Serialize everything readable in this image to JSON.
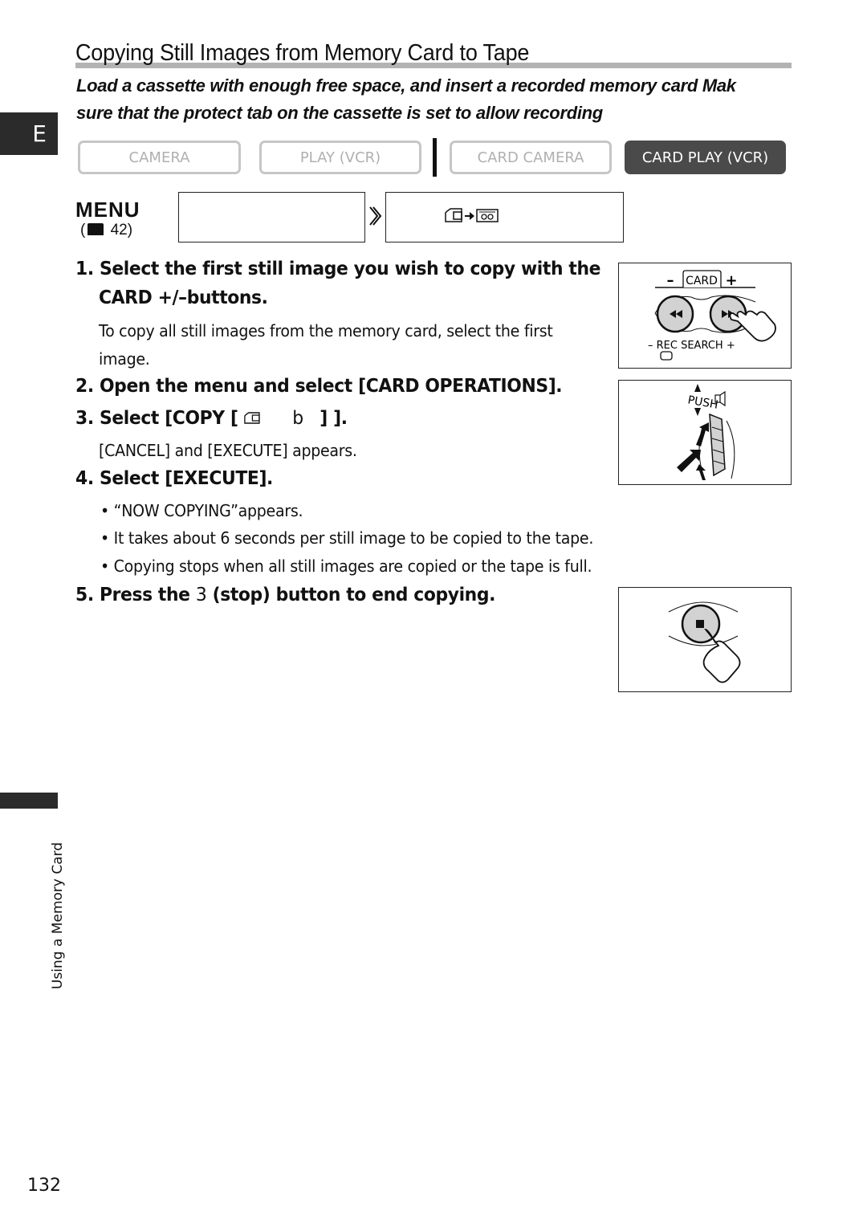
{
  "header": {
    "title": "Copying Still Images from Memory Card to Tape",
    "intro_line1": "Load a cassette with enough free space, and insert a recorded memory card  Mak",
    "intro_line2": "sure that the protect tab on the cassette is set to allow recording"
  },
  "language_tab": "E",
  "modes": [
    {
      "label": "CAMERA",
      "active": false
    },
    {
      "label": "PLAY (VCR)",
      "active": false
    },
    {
      "label": "CARD CAMERA",
      "active": false
    },
    {
      "label": "CARD PLAY (VCR)",
      "active": true
    }
  ],
  "menu": {
    "label": "MENU",
    "page_ref": "42",
    "box1_text": "",
    "box2_icon": "card-to-tape-icon"
  },
  "steps": [
    {
      "number": "1.",
      "line1": "Select the first still image you wish to copy with the",
      "line2": "CARD +/–buttons.",
      "note_line1": "To copy all still images from the memory card, select the first",
      "note_line2": "image."
    },
    {
      "number": "2.",
      "text": "Open the menu and select [CARD OPERATIONS]."
    },
    {
      "number": "3.",
      "text_pre": "Select [COPY [",
      "text_mid": "b",
      "text_post": "] ].",
      "note": "[CANCEL] and [EXECUTE] appears."
    },
    {
      "number": "4.",
      "text": "Select [EXECUTE].",
      "bullets": [
        "“NOW COPYING”appears.",
        "It takes about 6 seconds per still image to be copied to the tape.",
        "Copying stops when all still images are copied or the tape is full."
      ]
    },
    {
      "number": "5.",
      "text_pre": "Press the ",
      "symbol": "3",
      "text_post": " (stop) button to end copying."
    }
  ],
  "illustrations": {
    "card_buttons": {
      "card_label": "CARD",
      "minus": "–",
      "plus": "+",
      "rec_search": "REC SEARCH"
    },
    "push_dial": {
      "label": "PUSH"
    },
    "stop_button": {}
  },
  "side_label": "Using a Memory Card",
  "page_number": "132"
}
